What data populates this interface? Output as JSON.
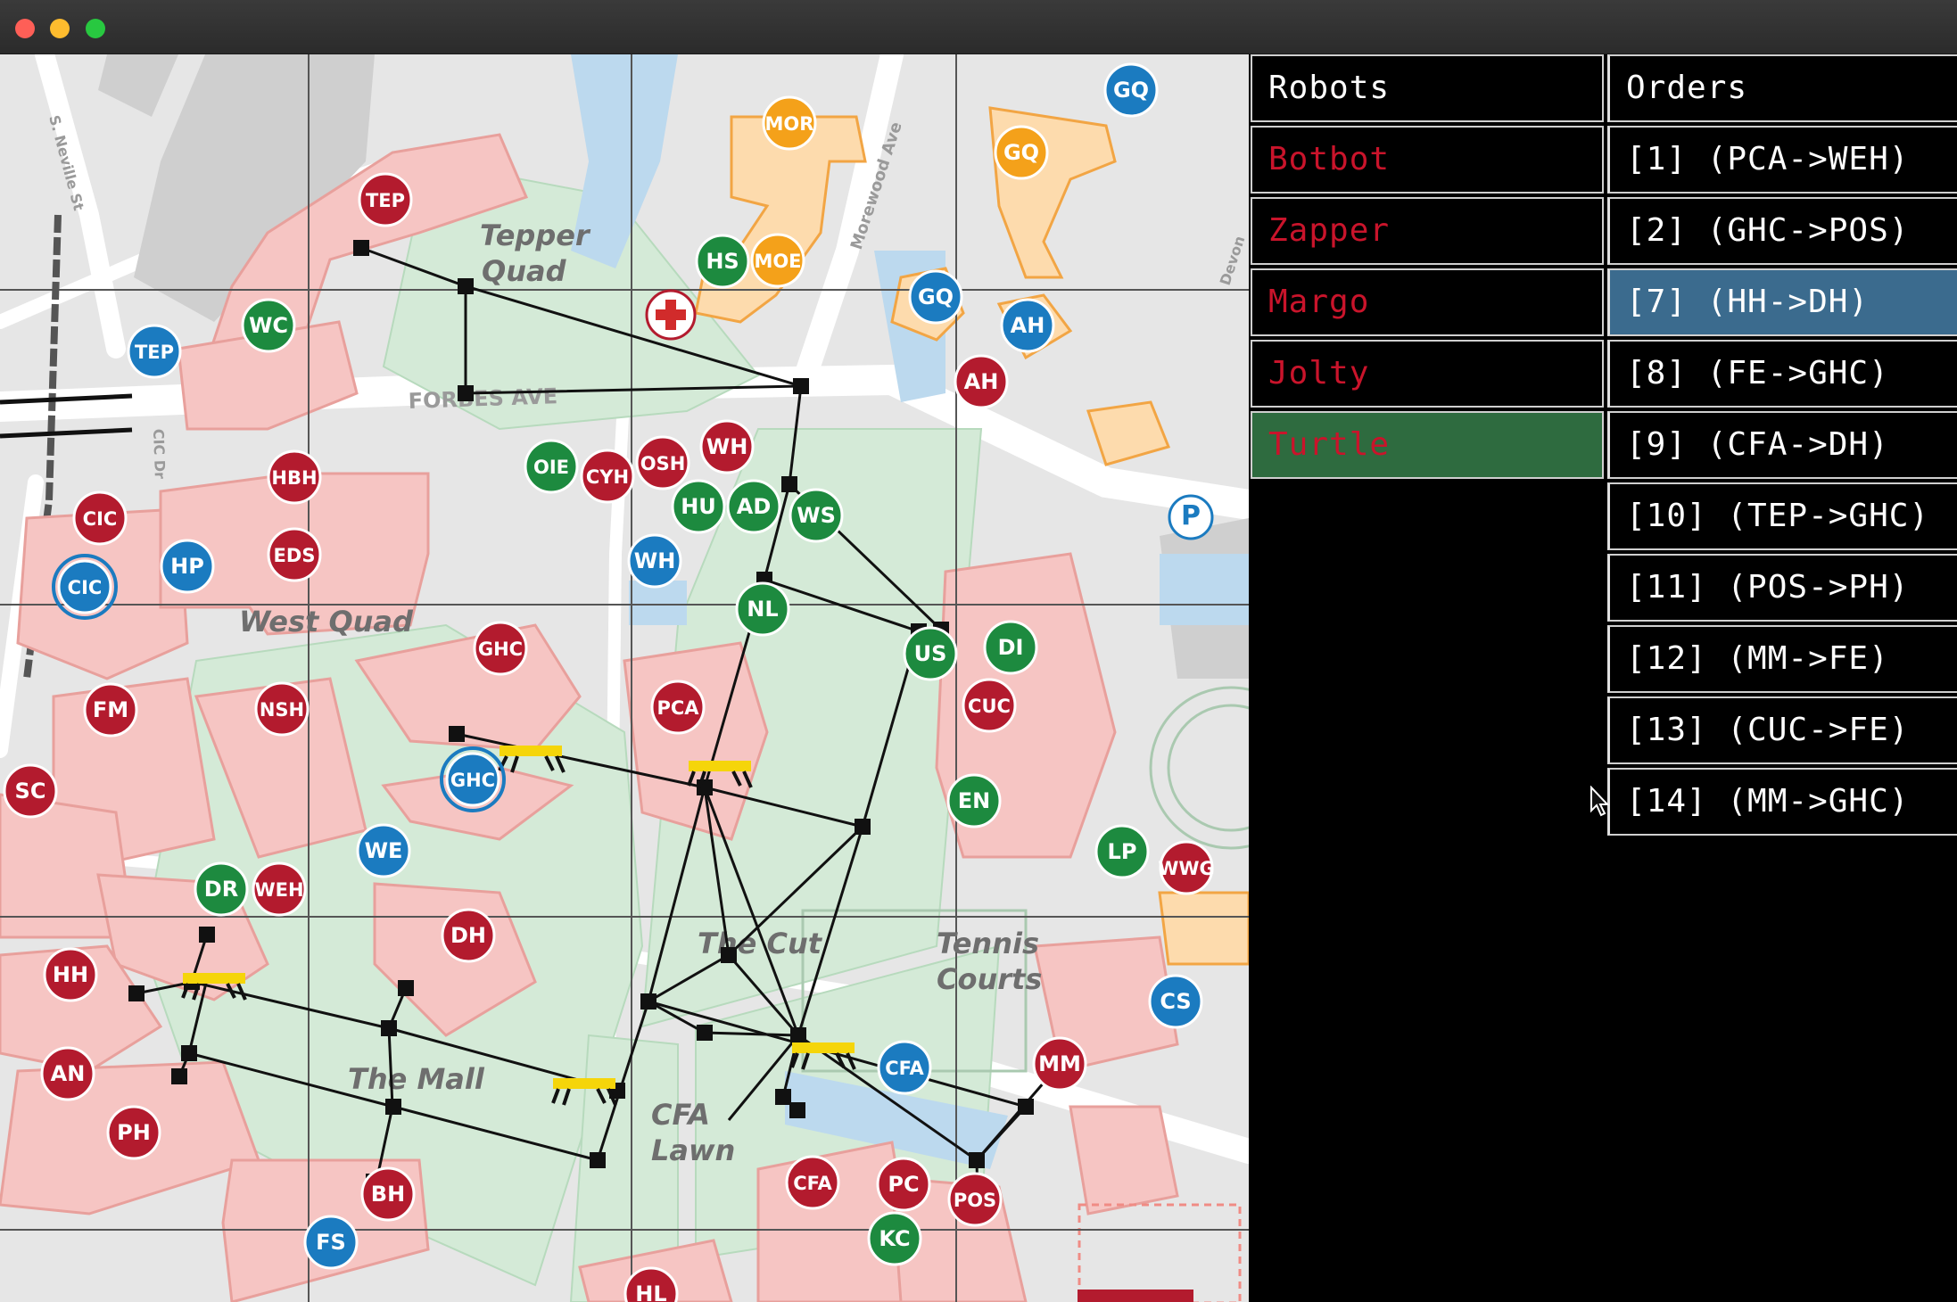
{
  "window": {
    "title": ""
  },
  "map": {
    "area_labels": [
      "Tepper Quad",
      "West Quad",
      "The Cut",
      "Tennis Courts",
      "The Mall",
      "CFA Lawn"
    ],
    "streets": [
      "S. Neville St",
      "FORBES AVE",
      "Morewood Ave",
      "CIC Dr",
      "Devon"
    ],
    "buildings": [
      {
        "code": "TEP",
        "color": "#b31b2e"
      },
      {
        "code": "WC",
        "color": "#1d8a3f"
      },
      {
        "code": "TEP",
        "color": "#1b7bc0"
      },
      {
        "code": "HBH",
        "color": "#b31b2e"
      },
      {
        "code": "CIC",
        "color": "#b31b2e"
      },
      {
        "code": "CIC",
        "color": "#1b7bc0"
      },
      {
        "code": "HP",
        "color": "#1b7bc0"
      },
      {
        "code": "EDS",
        "color": "#b31b2e"
      },
      {
        "code": "GHC",
        "color": "#b31b2e"
      },
      {
        "code": "FM",
        "color": "#b31b2e"
      },
      {
        "code": "NSH",
        "color": "#b31b2e"
      },
      {
        "code": "SC",
        "color": "#b31b2e"
      },
      {
        "code": "GHC",
        "color": "#1b7bc0"
      },
      {
        "code": "WE",
        "color": "#1b7bc0"
      },
      {
        "code": "DR",
        "color": "#1d8a3f"
      },
      {
        "code": "WEH",
        "color": "#b31b2e"
      },
      {
        "code": "DH",
        "color": "#b31b2e"
      },
      {
        "code": "HH",
        "color": "#b31b2e"
      },
      {
        "code": "AN",
        "color": "#b31b2e"
      },
      {
        "code": "PH",
        "color": "#b31b2e"
      },
      {
        "code": "BH",
        "color": "#b31b2e"
      },
      {
        "code": "FS",
        "color": "#1b7bc0"
      },
      {
        "code": "HL",
        "color": "#b31b2e"
      },
      {
        "code": "MOR",
        "color": "#f4a11a"
      },
      {
        "code": "GQ",
        "color": "#f4a11a"
      },
      {
        "code": "GQ",
        "color": "#1b7bc0"
      },
      {
        "code": "HS",
        "color": "#1d8a3f"
      },
      {
        "code": "MOE",
        "color": "#f4a11a"
      },
      {
        "code": "GQ",
        "color": "#1b7bc0"
      },
      {
        "code": "AH",
        "color": "#1b7bc0"
      },
      {
        "code": "AH",
        "color": "#b31b2e"
      },
      {
        "code": "OIE",
        "color": "#1d8a3f"
      },
      {
        "code": "CYH",
        "color": "#b31b2e"
      },
      {
        "code": "OSH",
        "color": "#b31b2e"
      },
      {
        "code": "WH",
        "color": "#b31b2e"
      },
      {
        "code": "HU",
        "color": "#1d8a3f"
      },
      {
        "code": "AD",
        "color": "#1d8a3f"
      },
      {
        "code": "WS",
        "color": "#1d8a3f"
      },
      {
        "code": "WH",
        "color": "#1b7bc0"
      },
      {
        "code": "NL",
        "color": "#1d8a3f"
      },
      {
        "code": "US",
        "color": "#1d8a3f"
      },
      {
        "code": "DI",
        "color": "#1d8a3f"
      },
      {
        "code": "CUC",
        "color": "#b31b2e"
      },
      {
        "code": "PCA",
        "color": "#b31b2e"
      },
      {
        "code": "EN",
        "color": "#1d8a3f"
      },
      {
        "code": "LP",
        "color": "#1d8a3f"
      },
      {
        "code": "WWG",
        "color": "#b31b2e"
      },
      {
        "code": "CS",
        "color": "#1b7bc0"
      },
      {
        "code": "MM",
        "color": "#b31b2e"
      },
      {
        "code": "CFA",
        "color": "#1b7bc0"
      },
      {
        "code": "CFA",
        "color": "#b31b2e"
      },
      {
        "code": "PC",
        "color": "#b31b2e"
      },
      {
        "code": "POS",
        "color": "#b31b2e"
      },
      {
        "code": "KC",
        "color": "#1d8a3f"
      },
      {
        "code": "P",
        "color": "#1b7bc0"
      }
    ]
  },
  "panel": {
    "robots_header": "Robots",
    "orders_header": "Orders",
    "robots": [
      {
        "name": "Botbot"
      },
      {
        "name": "Zapper"
      },
      {
        "name": "Margo"
      },
      {
        "name": "Jolty"
      },
      {
        "name": "Turtle",
        "selected": true
      }
    ],
    "orders": [
      {
        "label": "[1] (PCA->WEH)"
      },
      {
        "label": "[2] (GHC->POS)"
      },
      {
        "label": "[7] (HH->DH)",
        "selected": true
      },
      {
        "label": "[8] (FE->GHC)"
      },
      {
        "label": "[9] (CFA->DH)"
      },
      {
        "label": "[10] (TEP->GHC)"
      },
      {
        "label": "[11] (POS->PH)"
      },
      {
        "label": "[12] (MM->FE)"
      },
      {
        "label": "[13] (CUC->FE)"
      },
      {
        "label": "[14] (MM->GHC)"
      }
    ]
  },
  "colors": {
    "robot_text": "#c9142b",
    "selected_robot": "#2e6b3f",
    "selected_order": "#3b6b8e"
  }
}
